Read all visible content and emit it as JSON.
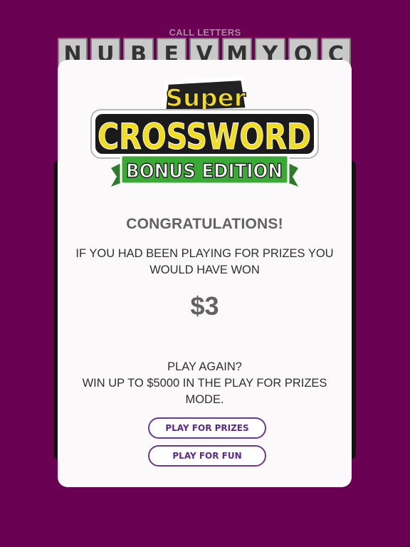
{
  "call_letters": {
    "label": "CALL LETTERS",
    "letters": [
      "N",
      "U",
      "B",
      "E",
      "V",
      "M",
      "Y",
      "O",
      "C"
    ]
  },
  "logo": {
    "line1": "Super",
    "line2": "CROSSWORD",
    "line3": "BONUS EDITION"
  },
  "modal": {
    "title": "CONGRATULATIONS!",
    "message": "IF YOU HAD BEEN PLAYING FOR PRIZES YOU WOULD HAVE WON",
    "amount": "$3",
    "play_again": "PLAY AGAIN?",
    "promo": "WIN UP TO $5000 IN THE PLAY FOR PRIZES MODE.",
    "btn_prizes": "PLAY FOR PRIZES",
    "btn_fun": "PLAY FOR FUN"
  },
  "colors": {
    "background": "#6a0052",
    "accent": "#5b2a86",
    "logo_yellow": "#f3dc1b",
    "logo_green": "#3aa935"
  }
}
